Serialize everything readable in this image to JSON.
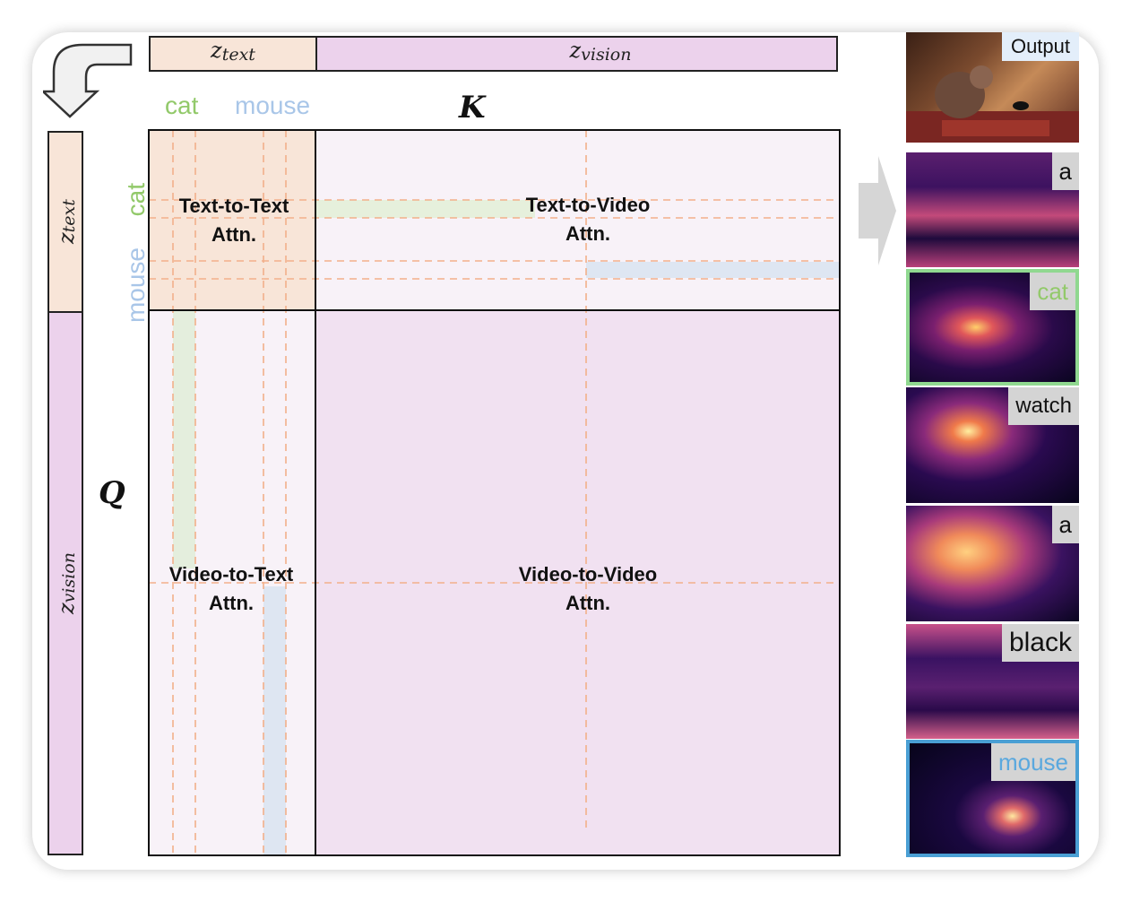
{
  "labels": {
    "z_text": "z",
    "z_text_sub": "text",
    "z_vision": "z",
    "z_vision_sub": "vision",
    "k": "K",
    "q": "Q"
  },
  "tokens": {
    "cat": "cat",
    "mouse": "mouse"
  },
  "regions": {
    "t2t": [
      "Text-to-Text",
      "Attn."
    ],
    "t2v": [
      "Text-to-Video",
      "Attn."
    ],
    "v2t": [
      "Video-to-Text",
      "Attn."
    ],
    "v2v": [
      "Video-to-Video",
      "Attn."
    ]
  },
  "panels": {
    "output": "Output",
    "maps": [
      "a",
      "cat",
      "watch",
      "a",
      "black",
      "mouse"
    ]
  },
  "colors": {
    "text_token": "#f8e5d8",
    "vision_token": "#ecd2ec",
    "cat_green": "#92c96a",
    "mouse_blue": "#a9c6e8",
    "cat_frame": "#90d890",
    "mouse_frame": "#4a9fd4",
    "dashed": "#f2b08a"
  },
  "icons": [
    "curved-arrow-icon",
    "right-arrow-icon"
  ]
}
